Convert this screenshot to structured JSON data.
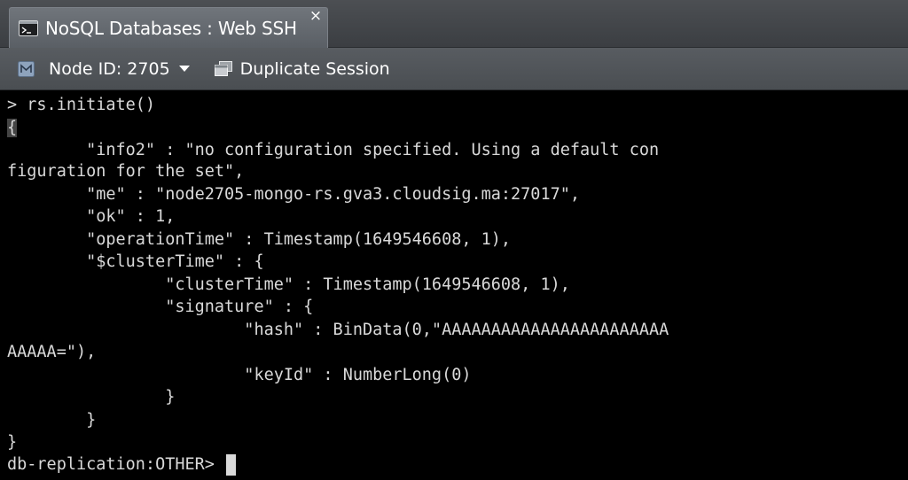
{
  "tab": {
    "title": "NoSQL Databases : Web SSH",
    "icon": "terminal-icon",
    "close_label": "×"
  },
  "toolbar": {
    "node_label": "Node ID: 2705",
    "node_icon": "node-icon",
    "duplicate_label": "Duplicate Session",
    "duplicate_icon": "duplicate-session-icon"
  },
  "terminal": {
    "lines": [
      "> rs.initiate()",
      "{",
      "        \"info2\" : \"no configuration specified. Using a default con",
      "figuration for the set\",",
      "        \"me\" : \"node2705-mongo-rs.gva3.cloudsig.ma:27017\",",
      "        \"ok\" : 1,",
      "        \"operationTime\" : Timestamp(1649546608, 1),",
      "        \"$clusterTime\" : {",
      "                \"clusterTime\" : Timestamp(1649546608, 1),",
      "                \"signature\" : {",
      "                        \"hash\" : BinData(0,\"AAAAAAAAAAAAAAAAAAAAAAA",
      "AAAAA=\"),",
      "                        \"keyId\" : NumberLong(0)",
      "                }",
      "        }",
      "}"
    ],
    "prompt": "db-replication:OTHER> "
  },
  "colors": {
    "tab_bg": "#62676d",
    "toolbar_bg": "#505458",
    "terminal_bg": "#000000",
    "terminal_fg": "#d9d9d9"
  }
}
